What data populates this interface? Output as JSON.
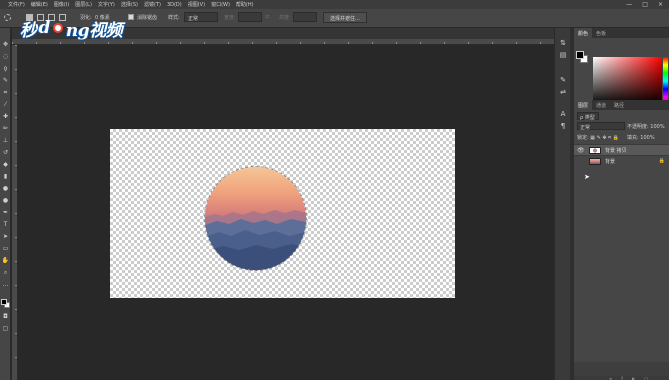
{
  "menubar": {
    "items": [
      "文件(F)",
      "编辑(E)",
      "图像(I)",
      "图层(L)",
      "文字(Y)",
      "选择(S)",
      "滤镜(T)",
      "3D(D)",
      "视图(V)",
      "窗口(W)",
      "帮助(H)"
    ],
    "window_controls": [
      "—",
      "□",
      "×"
    ]
  },
  "options": {
    "feather_label": "羽化:",
    "feather_value": "0 像素",
    "antialias_label": "消除锯齿",
    "style_label": "样式:",
    "style_value": "正常",
    "width_label": "宽度:",
    "height_label": "高度:",
    "select_mask_button": "选择并遮住..."
  },
  "watermark": {
    "part1": "秒",
    "part2": "d",
    "part3": "ng视频"
  },
  "color_panel": {
    "tabs": [
      "颜色",
      "色板"
    ]
  },
  "layers_panel": {
    "tabs": [
      "图层",
      "通道",
      "路径"
    ],
    "filter": "ρ 类型",
    "blend_mode": "正常",
    "opacity_label": "不透明度:",
    "opacity_value": "100%",
    "lock_label": "锁定:",
    "fill_label": "填充:",
    "fill_value": "100%",
    "layers": [
      {
        "name": "背景 拷贝",
        "selected": true,
        "visible": true
      },
      {
        "name": "背景",
        "selected": false,
        "visible": false,
        "locked": true
      }
    ]
  },
  "colors": {
    "canvas_bg": "#282828",
    "panel_bg": "#464646",
    "accent": "#1b6cc4"
  }
}
